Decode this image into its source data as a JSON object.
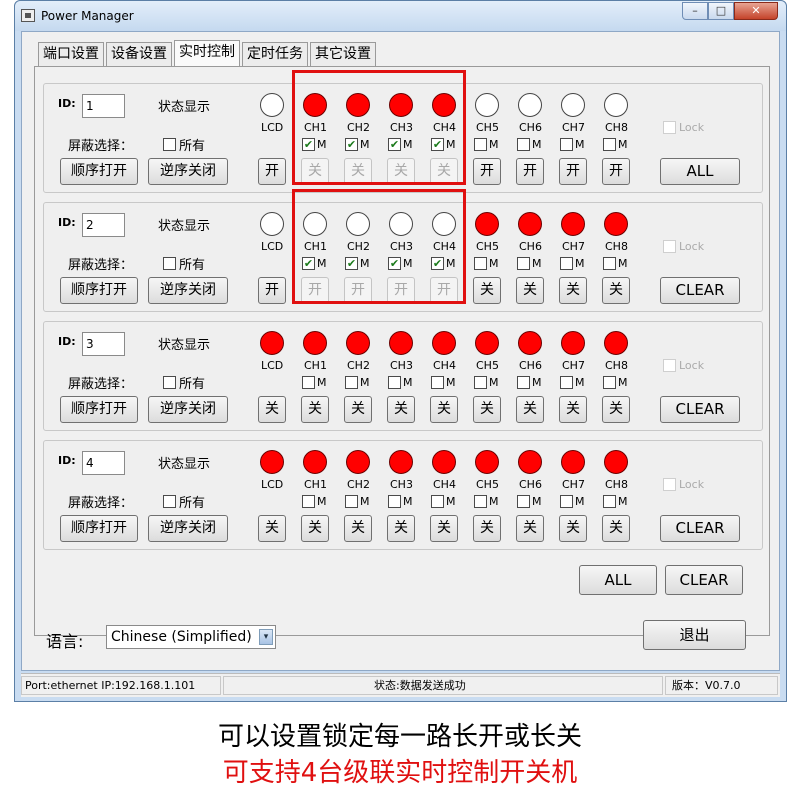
{
  "window": {
    "title": "Power Manager",
    "minimize": "–",
    "maximize": "□",
    "close": "✕"
  },
  "tabs": [
    "端口设置",
    "设备设置",
    "实时控制",
    "定时任务",
    "其它设置"
  ],
  "labels": {
    "id": "ID:",
    "status_display": "状态显示",
    "mask_select": "屏蔽选择：",
    "all_checkbox": "所有",
    "seq_open": "顺序打开",
    "rev_close": "逆序关闭",
    "lcd": "LCD",
    "m": "M",
    "lock": "Lock"
  },
  "channels": [
    "CH1",
    "CH2",
    "CH3",
    "CH4",
    "CH5",
    "CH6",
    "CH7",
    "CH8"
  ],
  "groups": [
    {
      "id": "1",
      "lcd_on": false,
      "leds": [
        true,
        true,
        true,
        true,
        false,
        false,
        false,
        false
      ],
      "m_checked": [
        true,
        true,
        true,
        true,
        false,
        false,
        false,
        false
      ],
      "lcd_btn": "开",
      "ch_btns": [
        "关",
        "关",
        "关",
        "关",
        "开",
        "开",
        "开",
        "开"
      ],
      "ch_btn_disabled": [
        true,
        true,
        true,
        true,
        false,
        false,
        false,
        false
      ],
      "right_btn": "ALL"
    },
    {
      "id": "2",
      "lcd_on": false,
      "leds": [
        false,
        false,
        false,
        false,
        true,
        true,
        true,
        true
      ],
      "m_checked": [
        true,
        true,
        true,
        true,
        false,
        false,
        false,
        false
      ],
      "lcd_btn": "开",
      "ch_btns": [
        "开",
        "开",
        "开",
        "开",
        "关",
        "关",
        "关",
        "关"
      ],
      "ch_btn_disabled": [
        true,
        true,
        true,
        true,
        false,
        false,
        false,
        false
      ],
      "right_btn": "CLEAR"
    },
    {
      "id": "3",
      "lcd_on": true,
      "leds": [
        true,
        true,
        true,
        true,
        true,
        true,
        true,
        true
      ],
      "m_checked": [
        false,
        false,
        false,
        false,
        false,
        false,
        false,
        false
      ],
      "lcd_btn": "关",
      "ch_btns": [
        "关",
        "关",
        "关",
        "关",
        "关",
        "关",
        "关",
        "关"
      ],
      "ch_btn_disabled": [
        false,
        false,
        false,
        false,
        false,
        false,
        false,
        false
      ],
      "right_btn": "CLEAR"
    },
    {
      "id": "4",
      "lcd_on": true,
      "leds": [
        true,
        true,
        true,
        true,
        true,
        true,
        true,
        true
      ],
      "m_checked": [
        false,
        false,
        false,
        false,
        false,
        false,
        false,
        false
      ],
      "lcd_btn": "关",
      "ch_btns": [
        "关",
        "关",
        "关",
        "关",
        "关",
        "关",
        "关",
        "关"
      ],
      "ch_btn_disabled": [
        false,
        false,
        false,
        false,
        false,
        false,
        false,
        false
      ],
      "right_btn": "CLEAR"
    }
  ],
  "bottom": {
    "all_btn": "ALL",
    "clear_btn": "CLEAR",
    "language_label": "语言:",
    "language_value": "Chinese (Simplified)",
    "exit_btn": "退出"
  },
  "statusbar": {
    "port": "Port:ethernet IP:192.168.1.101",
    "status": "状态:数据发送成功",
    "version": "版本：V0.7.0"
  },
  "captions": {
    "line1": "可以设置锁定每一路长开或长关",
    "line2": "可支持4台级联实时控制开关机"
  },
  "colors": {
    "led_on": "#ff0000",
    "highlight": "#e01010",
    "caption_red": "#e01010"
  },
  "icons": {
    "check": "✔",
    "select_arrow": "▾"
  }
}
